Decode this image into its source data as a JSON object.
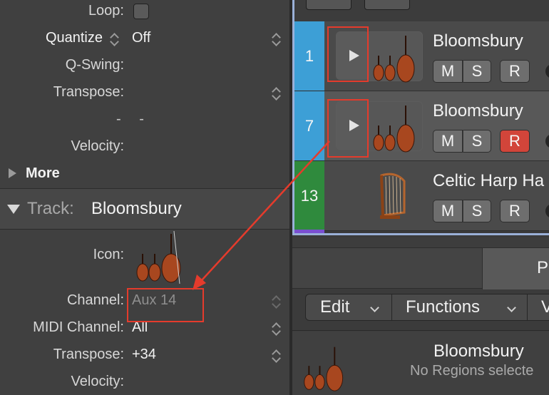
{
  "region_inspector": {
    "loop_label": "Loop:",
    "quantize_label": "Quantize",
    "quantize_value": "Off",
    "qswing_label": "Q-Swing:",
    "transpose_label": "Transpose:",
    "dashes": "- -",
    "velocity_label": "Velocity:",
    "more_label": "More"
  },
  "track_inspector": {
    "header_label": "Track:",
    "header_name": "Bloomsbury",
    "icon_label": "Icon:",
    "icon_name": "violin-ensemble-icon",
    "channel_label": "Channel:",
    "channel_value": "Aux 14",
    "midi_channel_label": "MIDI Channel:",
    "midi_channel_value": "All",
    "transpose_label": "Transpose:",
    "transpose_value": "+34",
    "velocity_label": "Velocity:"
  },
  "tracks": [
    {
      "number": "1",
      "name": "Bloomsbury",
      "color": "#3d9fd6",
      "icon": "violin-ensemble-icon",
      "record_active": false
    },
    {
      "number": "7",
      "name": "Bloomsbury",
      "color": "#3d9fd6",
      "icon": "violin-ensemble-icon",
      "record_active": true
    },
    {
      "number": "13",
      "name": "Celtic Harp Ha",
      "color": "#2f8a3d",
      "icon": "harp-icon",
      "record_active": false
    }
  ],
  "track_buttons": {
    "mute": "M",
    "solo": "S",
    "record": "R"
  },
  "editor": {
    "tab_right_label": "P",
    "edit_menu": "Edit",
    "functions_menu": "Functions",
    "view_menu": "V",
    "region_name": "Bloomsbury",
    "region_status": "No Regions selecte"
  },
  "colors": {
    "annotation_red": "#e53b2c",
    "record_red": "#d2453a",
    "selection_outline": "#9ab0d8"
  }
}
